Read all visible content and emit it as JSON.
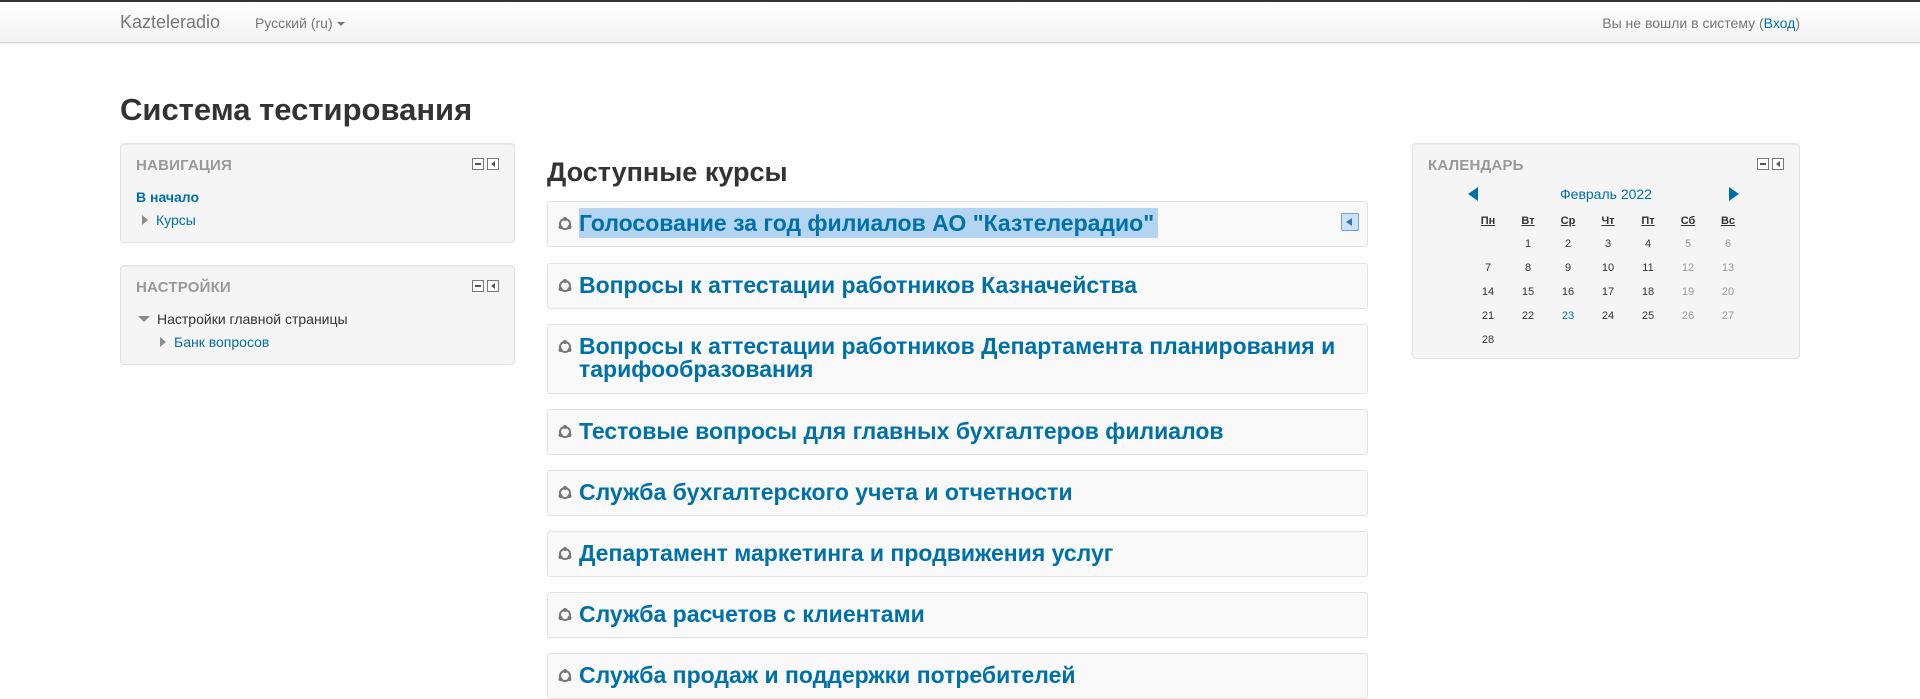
{
  "navbar": {
    "brand": "Kazteleradio",
    "language": "Русский (ru)",
    "login_text": "Вы не вошли в систему (",
    "login_link": "Вход",
    "login_close": ")"
  },
  "page": {
    "title": "Система тестирования"
  },
  "navigation_block": {
    "title": "НАВИГАЦИЯ",
    "home": "В начало",
    "items": [
      {
        "label": "Курсы"
      }
    ]
  },
  "settings_block": {
    "title": "НАСТРОЙКИ",
    "group": "Настройки главной страницы",
    "items": [
      {
        "label": "Банк вопросов"
      }
    ]
  },
  "main": {
    "title": "Доступные курсы",
    "courses": [
      {
        "name": "Голосование за год филиалов АО \"Казтелерадио\"",
        "selected": true
      },
      {
        "name": "Вопросы к аттестации работников Казначейства"
      },
      {
        "name": "Вопросы к аттестации работников Департамента планирования и тарифообразования"
      },
      {
        "name": "Тестовые вопросы для главных бухгалтеров филиалов"
      },
      {
        "name": "Служба бухгалтерского учета и отчетности"
      },
      {
        "name": "Департамент маркетинга и продвижения услуг"
      },
      {
        "name": "Служба расчетов с клиентами"
      },
      {
        "name": "Служба продаж и поддержки потребителей"
      }
    ]
  },
  "calendar": {
    "title": "КАЛЕНДАРЬ",
    "month": "Февраль 2022",
    "weekdays": [
      "Пн",
      "Вт",
      "Ср",
      "Чт",
      "Пт",
      "Сб",
      "Вс"
    ],
    "weeks": [
      [
        "",
        "1",
        "2",
        "3",
        "4",
        "5",
        "6"
      ],
      [
        "7",
        "8",
        "9",
        "10",
        "11",
        "12",
        "13"
      ],
      [
        "14",
        "15",
        "16",
        "17",
        "18",
        "19",
        "20"
      ],
      [
        "21",
        "22",
        "23",
        "24",
        "25",
        "26",
        "27"
      ],
      [
        "28",
        "",
        "",
        "",
        "",
        "",
        ""
      ]
    ],
    "today": "23"
  },
  "colors": {
    "link": "#0070a8",
    "selection": "#b4d5f2",
    "block_bg": "#f5f5f5"
  }
}
